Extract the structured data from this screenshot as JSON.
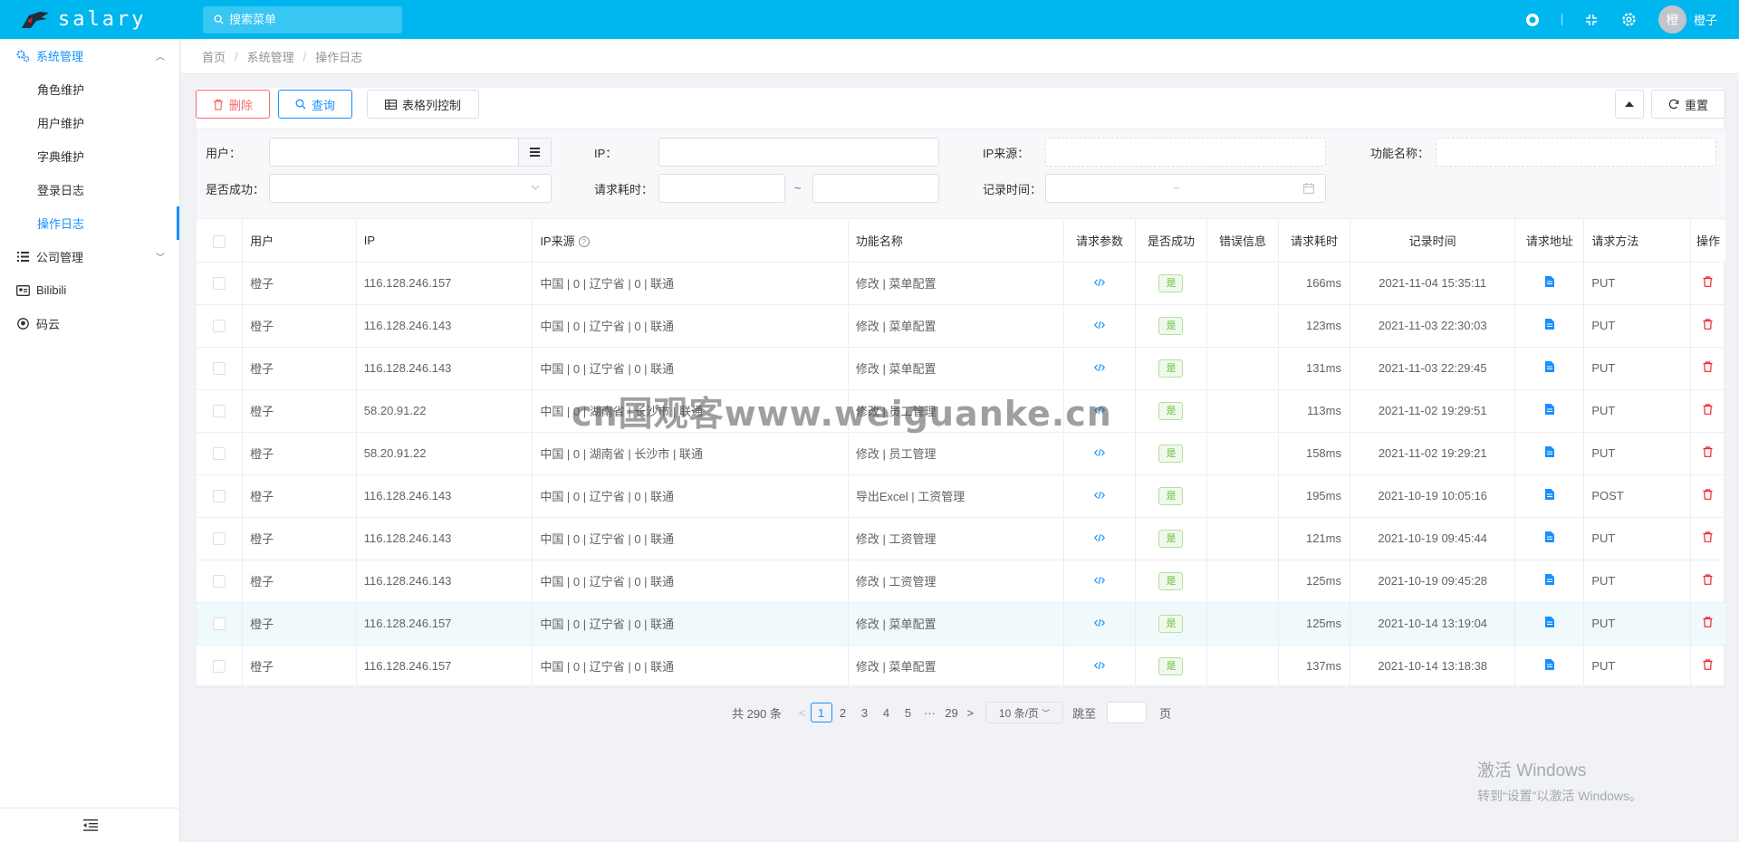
{
  "app": {
    "name": "salary",
    "brand_color": "#00b6ef",
    "accent_color": "#1890ff"
  },
  "header": {
    "search_placeholder": "搜索菜单",
    "user_initial": "橙",
    "user_name": "橙子",
    "icons": [
      "github-icon",
      "fullscreen-icon",
      "gear-icon"
    ]
  },
  "sidebar": {
    "items": [
      {
        "label": "系统管理",
        "icon": "gears-icon",
        "expanded": true,
        "children": [
          "角色维护",
          "用户维护",
          "字典维护",
          "登录日志",
          "操作日志"
        ]
      },
      {
        "label": "公司管理",
        "icon": "list-icon",
        "expanded": false
      },
      {
        "label": "Bilibili",
        "icon": "id-card-icon"
      },
      {
        "label": "码云",
        "icon": "github-icon"
      }
    ],
    "active_child": "操作日志"
  },
  "breadcrumb": [
    "首页",
    "系统管理",
    "操作日志"
  ],
  "toolbar": {
    "delete": "删除",
    "query": "查询",
    "columns": "表格列控制",
    "reset": "重置"
  },
  "filters": {
    "user": "用户：",
    "ip": "IP：",
    "ip_source": "IP来源：",
    "func_name": "功能名称：",
    "success": "是否成功：",
    "duration": "请求耗时：",
    "record_time": "记录时间：",
    "tilde": "~"
  },
  "table": {
    "headers": [
      "用户",
      "IP",
      "IP来源",
      "功能名称",
      "请求参数",
      "是否成功",
      "错误信息",
      "请求耗时",
      "记录时间",
      "请求地址",
      "请求方法",
      "操作"
    ],
    "rows": [
      {
        "user": "橙子",
        "ip": "116.128.246.157",
        "source": "中国 | 0 | 辽宁省 | 0 | 联通",
        "func": "修改 | 菜单配置",
        "ok": "是",
        "err": "",
        "ms": "166ms",
        "time": "2021-11-04 15:35:11",
        "method": "PUT"
      },
      {
        "user": "橙子",
        "ip": "116.128.246.143",
        "source": "中国 | 0 | 辽宁省 | 0 | 联通",
        "func": "修改 | 菜单配置",
        "ok": "是",
        "err": "",
        "ms": "123ms",
        "time": "2021-11-03 22:30:03",
        "method": "PUT"
      },
      {
        "user": "橙子",
        "ip": "116.128.246.143",
        "source": "中国 | 0 | 辽宁省 | 0 | 联通",
        "func": "修改 | 菜单配置",
        "ok": "是",
        "err": "",
        "ms": "131ms",
        "time": "2021-11-03 22:29:45",
        "method": "PUT"
      },
      {
        "user": "橙子",
        "ip": "58.20.91.22",
        "source": "中国 | 0 | 湖南省 | 长沙市 | 联通",
        "func": "修改 | 员工管理",
        "ok": "是",
        "err": "",
        "ms": "113ms",
        "time": "2021-11-02 19:29:51",
        "method": "PUT"
      },
      {
        "user": "橙子",
        "ip": "58.20.91.22",
        "source": "中国 | 0 | 湖南省 | 长沙市 | 联通",
        "func": "修改 | 员工管理",
        "ok": "是",
        "err": "",
        "ms": "158ms",
        "time": "2021-11-02 19:29:21",
        "method": "PUT"
      },
      {
        "user": "橙子",
        "ip": "116.128.246.143",
        "source": "中国 | 0 | 辽宁省 | 0 | 联通",
        "func": "导出Excel | 工资管理",
        "ok": "是",
        "err": "",
        "ms": "195ms",
        "time": "2021-10-19 10:05:16",
        "method": "POST"
      },
      {
        "user": "橙子",
        "ip": "116.128.246.143",
        "source": "中国 | 0 | 辽宁省 | 0 | 联通",
        "func": "修改 | 工资管理",
        "ok": "是",
        "err": "",
        "ms": "121ms",
        "time": "2021-10-19 09:45:44",
        "method": "PUT"
      },
      {
        "user": "橙子",
        "ip": "116.128.246.143",
        "source": "中国 | 0 | 辽宁省 | 0 | 联通",
        "func": "修改 | 工资管理",
        "ok": "是",
        "err": "",
        "ms": "125ms",
        "time": "2021-10-19 09:45:28",
        "method": "PUT"
      },
      {
        "user": "橙子",
        "ip": "116.128.246.157",
        "source": "中国 | 0 | 辽宁省 | 0 | 联通",
        "func": "修改 | 菜单配置",
        "ok": "是",
        "err": "",
        "ms": "125ms",
        "time": "2021-10-14 13:19:04",
        "method": "PUT"
      },
      {
        "user": "橙子",
        "ip": "116.128.246.157",
        "source": "中国 | 0 | 辽宁省 | 0 | 联通",
        "func": "修改 | 菜单配置",
        "ok": "是",
        "err": "",
        "ms": "137ms",
        "time": "2021-10-14 13:18:38",
        "method": "PUT"
      }
    ]
  },
  "pagination": {
    "total": "共 290 条",
    "pages": [
      "1",
      "2",
      "3",
      "4",
      "5"
    ],
    "ellipsis": "···",
    "last": "29",
    "current": "1",
    "page_size": "10 条/页",
    "jump_label": "跳至",
    "page_unit": "页"
  },
  "watermark": "cn国观客www.weiguanke.cn",
  "activation": {
    "title": "激活 Windows",
    "hint": "转到“设置”以激活 Windows。"
  }
}
